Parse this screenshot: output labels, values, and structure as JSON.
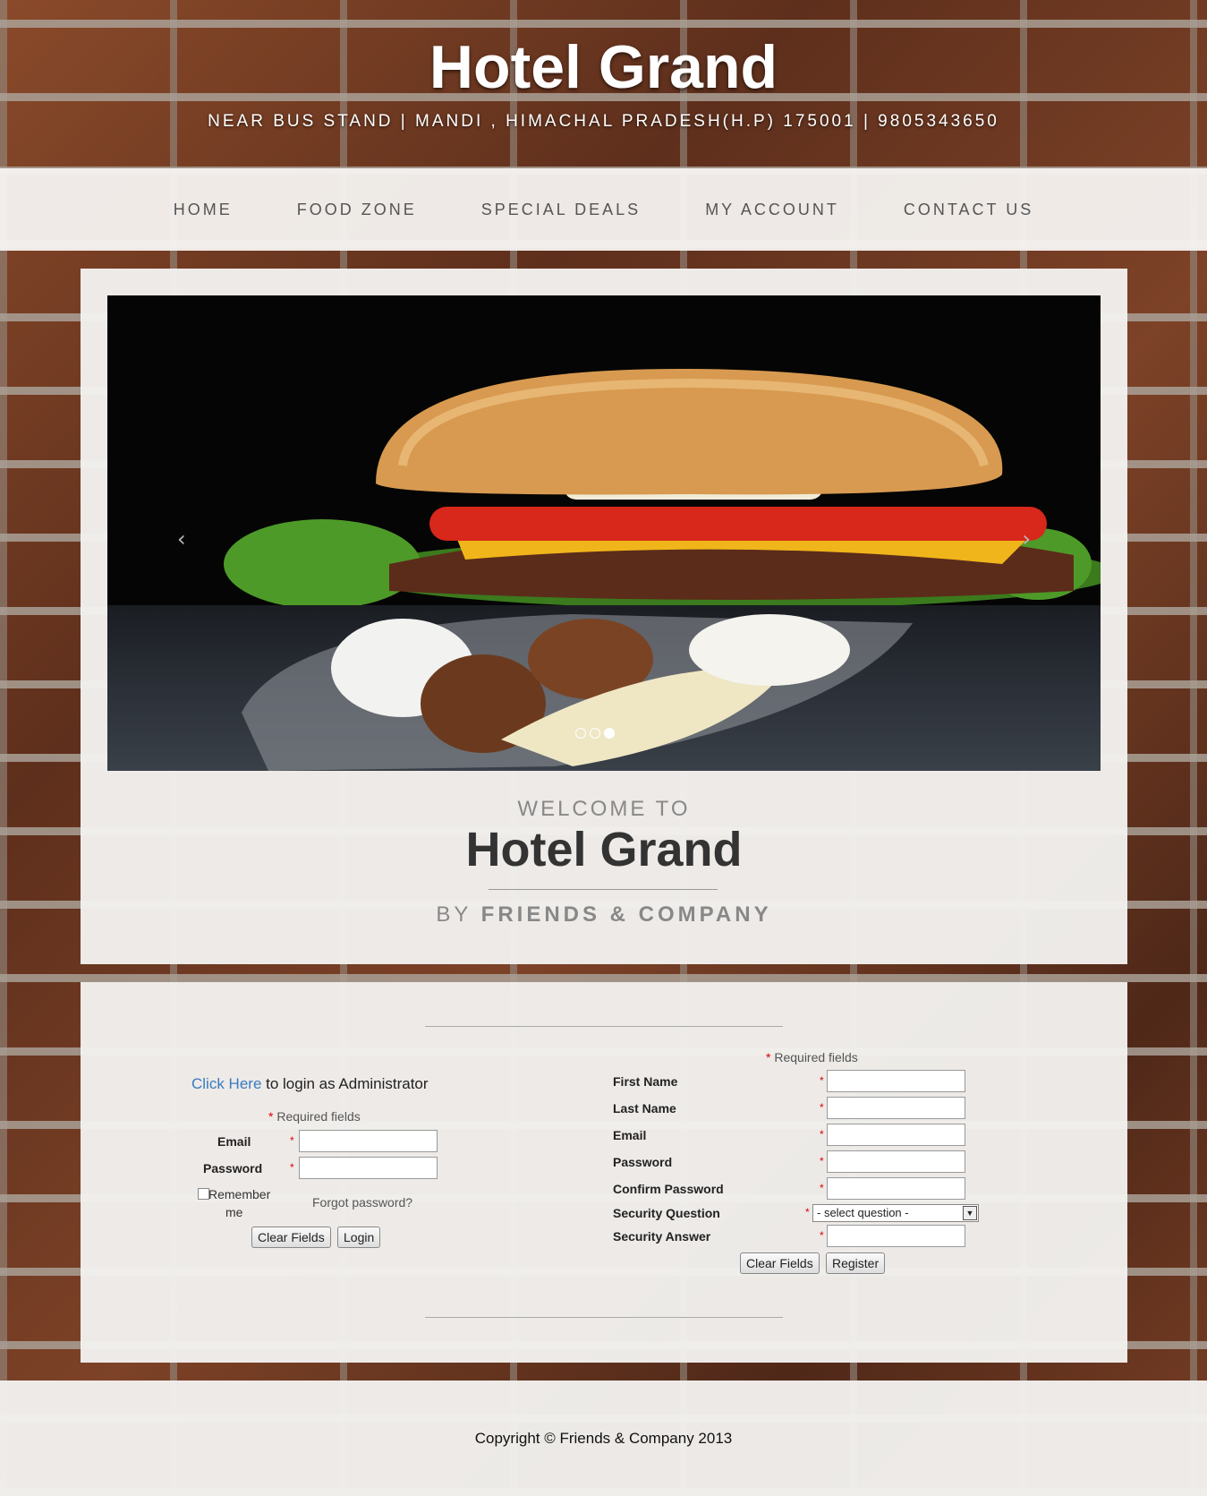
{
  "header": {
    "title": "Hotel Grand",
    "address": "NEAR BUS STAND | MANDI , HIMACHAL PRADESH(H.P) 175001 | 9805343650"
  },
  "nav": {
    "items": [
      "HOME",
      "FOOD ZONE",
      "SPECIAL DEALS",
      "MY ACCOUNT",
      "CONTACT US"
    ]
  },
  "slider": {
    "prev": "‹",
    "next": "›",
    "dots": 3,
    "active_dot": 3
  },
  "welcome": {
    "line1": "WELCOME TO",
    "title": "Hotel Grand",
    "by": "BY",
    "company": "FRIENDS & COMPANY"
  },
  "login": {
    "click_here": "Click Here",
    "admin_text": " to login as Administrator",
    "required": "Required fields",
    "email_label": "Email",
    "password_label": "Password",
    "remember_line1": "Remember",
    "remember_line2": "me",
    "forgot": "Forgot password?",
    "clear_button": "Clear Fields",
    "login_button": "Login"
  },
  "register": {
    "required": "Required fields",
    "fields": [
      "First Name",
      "Last Name",
      "Email",
      "Password",
      "Confirm Password",
      "Security Question",
      "Security Answer"
    ],
    "security_question_value": "- select question -",
    "clear_button": "Clear Fields",
    "register_button": "Register"
  },
  "footer": {
    "copyright": "Copyright © Friends & Company 2013"
  }
}
